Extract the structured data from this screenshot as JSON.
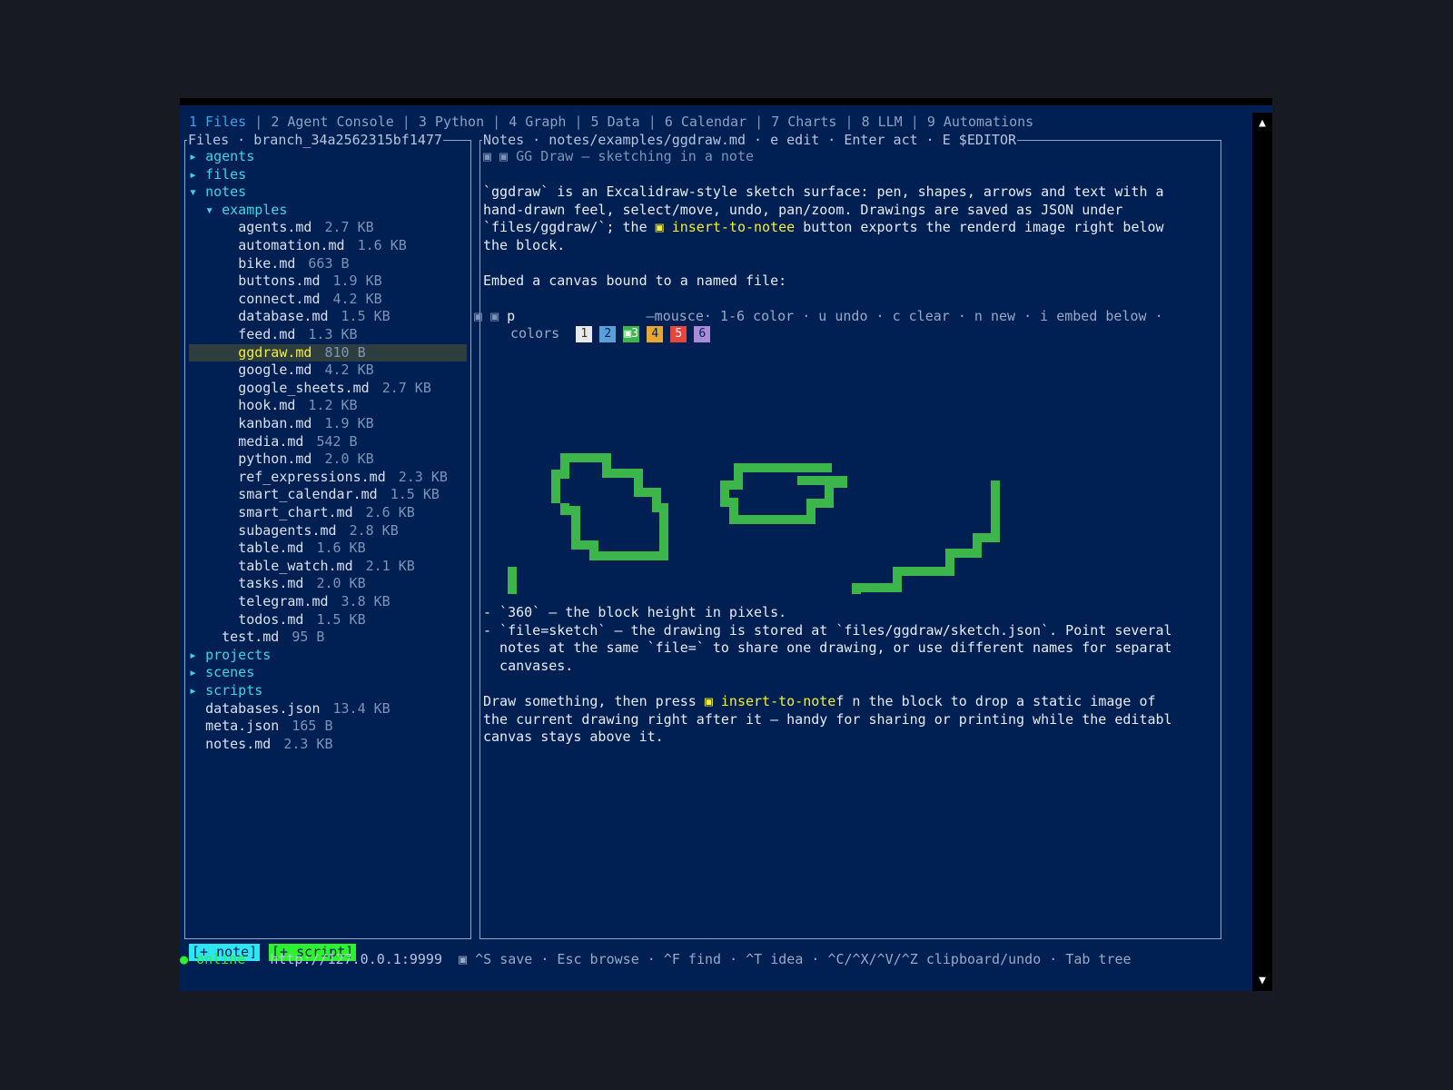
{
  "tabs": [
    "1 Files",
    "2 Agent Console",
    "3 Python",
    "4 Graph",
    "5 Data",
    "6 Calendar",
    "7 Charts",
    "8 LLM",
    "9 Automations"
  ],
  "active_tab": 0,
  "left_title": "Files · branch_34a2562315bf1477",
  "right_title": "Notes · notes/examples/ggdraw.md · e edit · Enter act · E $EDITOR",
  "tree": [
    {
      "indent": 0,
      "arrow": "▸",
      "name": "agents",
      "dir": true
    },
    {
      "indent": 0,
      "arrow": "▸",
      "name": "files",
      "dir": true
    },
    {
      "indent": 0,
      "arrow": "▾",
      "name": "notes",
      "dir": true
    },
    {
      "indent": 1,
      "arrow": "▾",
      "name": "examples",
      "dir": true
    },
    {
      "indent": 2,
      "name": "agents.md",
      "size": "2.7 KB"
    },
    {
      "indent": 2,
      "name": "automation.md",
      "size": "1.6 KB"
    },
    {
      "indent": 2,
      "name": "bike.md",
      "size": "663 B"
    },
    {
      "indent": 2,
      "name": "buttons.md",
      "size": "1.9 KB"
    },
    {
      "indent": 2,
      "name": "connect.md",
      "size": "4.2 KB"
    },
    {
      "indent": 2,
      "name": "database.md",
      "size": "1.5 KB"
    },
    {
      "indent": 2,
      "name": "feed.md",
      "size": "1.3 KB"
    },
    {
      "indent": 2,
      "name": "ggdraw.md",
      "size": "810 B",
      "selected": true
    },
    {
      "indent": 2,
      "name": "google.md",
      "size": "4.2 KB"
    },
    {
      "indent": 2,
      "name": "google_sheets.md",
      "size": "2.7 KB"
    },
    {
      "indent": 2,
      "name": "hook.md",
      "size": "1.2 KB"
    },
    {
      "indent": 2,
      "name": "kanban.md",
      "size": "1.9 KB"
    },
    {
      "indent": 2,
      "name": "media.md",
      "size": "542 B"
    },
    {
      "indent": 2,
      "name": "python.md",
      "size": "2.0 KB"
    },
    {
      "indent": 2,
      "name": "ref_expressions.md",
      "size": "2.3 KB"
    },
    {
      "indent": 2,
      "name": "smart_calendar.md",
      "size": "1.5 KB"
    },
    {
      "indent": 2,
      "name": "smart_chart.md",
      "size": "2.6 KB"
    },
    {
      "indent": 2,
      "name": "subagents.md",
      "size": "2.8 KB"
    },
    {
      "indent": 2,
      "name": "table.md",
      "size": "1.6 KB"
    },
    {
      "indent": 2,
      "name": "table_watch.md",
      "size": "2.1 KB"
    },
    {
      "indent": 2,
      "name": "tasks.md",
      "size": "2.0 KB"
    },
    {
      "indent": 2,
      "name": "telegram.md",
      "size": "3.8 KB"
    },
    {
      "indent": 2,
      "name": "todos.md",
      "size": "1.5 KB"
    },
    {
      "indent": 1,
      "name": "test.md",
      "size": "95 B"
    },
    {
      "indent": 0,
      "arrow": "▸",
      "name": "projects",
      "dir": true
    },
    {
      "indent": 0,
      "arrow": "▸",
      "name": "scenes",
      "dir": true
    },
    {
      "indent": 0,
      "arrow": "▸",
      "name": "scripts",
      "dir": true
    },
    {
      "indent": 0,
      "name": "databases.json",
      "size": "13.4 KB"
    },
    {
      "indent": 0,
      "name": "meta.json",
      "size": "165 B"
    },
    {
      "indent": 0,
      "name": "notes.md",
      "size": "2.3 KB"
    }
  ],
  "note": {
    "heading": "▣ ▣ GG Draw — sketching in a note",
    "p1_l1": "`ggdraw` is an Excalidraw-style sketch surface: pen, shapes, arrows and text with a",
    "p1_l2": "hand-drawn feel, select/move, undo, pan/zoom. Drawings are saved as JSON under",
    "p1_l3a": "`files/ggdraw/`; the ",
    "p1_l3b": "▣ insert-to-notee",
    "p1_l3c": " button exports the renderd image right below",
    "p1_l4": "the block.",
    "p2": "Embed a canvas bound to a named file:",
    "canvas_icon": "▣",
    "canvas_mode": "p",
    "canvas_hint": "—mousce· 1-6 color · u undo · c clear · n new · i embed below ·",
    "colors_label": "colors",
    "colors": [
      {
        "label": "1",
        "bg": "#e8e8e8",
        "fg": "#333"
      },
      {
        "label": "2",
        "bg": "#5a9fd6",
        "fg": "#001f52"
      },
      {
        "label": "▣3",
        "bg": "#3cb54a",
        "fg": "#fff"
      },
      {
        "label": "4",
        "bg": "#e6a82e",
        "fg": "#001f52"
      },
      {
        "label": "5",
        "bg": "#e6463c",
        "fg": "#fff"
      },
      {
        "label": "6",
        "bg": "#a88cd9",
        "fg": "#001f52"
      }
    ],
    "b1": "- `360` — the block height in pixels.",
    "b2_l1": "- `file=sketch` — the drawing is stored at `files/ggdraw/sketch.json`. Point several",
    "b2_l2": "  notes at the same `file=` to share one drawing, or use different names for separat",
    "b2_l3": "  canvases.",
    "p3_l1a": "Draw something, then press ",
    "p3_l1b": "▣ insert-to-note",
    "p3_l1c": "f n the block to drop a static image of",
    "p3_l2": "the current drawing right after it — handy for sharing or printing while the editabl",
    "p3_l3": "canvas stays above it."
  },
  "buttons": {
    "note": "[+ note]",
    "script": "[+ script]"
  },
  "status": {
    "dot": "●",
    "online": "online",
    "url": "http://127.0.0.1:9999",
    "hints": "▣ ^S save · Esc browse · ^F find · ^T idea · ^C/^X/^V/^Z clipboard/undo · Tab tree"
  },
  "scroll": {
    "up": "▲",
    "down": "▼"
  },
  "drawing_color": "#3cb54a"
}
